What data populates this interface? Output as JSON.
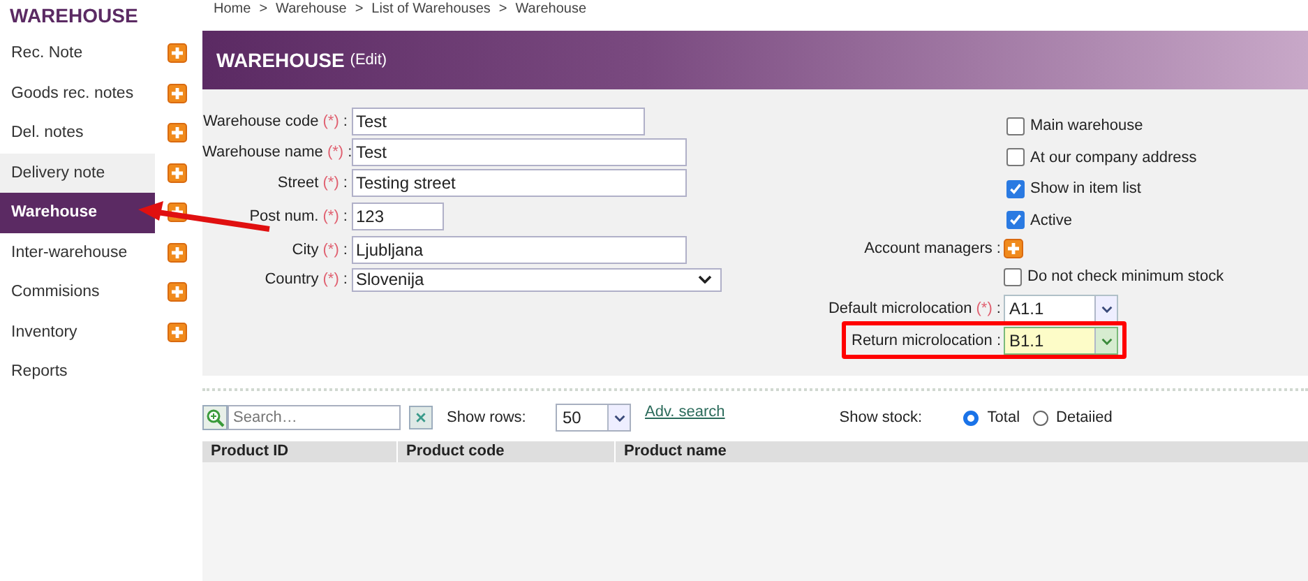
{
  "sidebar": {
    "title": "WAREHOUSE",
    "items": [
      {
        "label": "Rec. Note",
        "selected": false,
        "hovered": false,
        "has_add": true
      },
      {
        "label": "Goods rec. notes",
        "selected": false,
        "hovered": false,
        "has_add": true
      },
      {
        "label": "Del. notes",
        "selected": false,
        "hovered": false,
        "has_add": true
      },
      {
        "label": "Delivery note",
        "selected": false,
        "hovered": true,
        "has_add": true
      },
      {
        "label": "Warehouse",
        "selected": true,
        "hovered": false,
        "has_add": true
      },
      {
        "label": "Inter-warehouse",
        "selected": false,
        "hovered": false,
        "has_add": true
      },
      {
        "label": "Commisions",
        "selected": false,
        "hovered": false,
        "has_add": true
      },
      {
        "label": "Inventory",
        "selected": false,
        "hovered": false,
        "has_add": true
      },
      {
        "label": "Reports",
        "selected": false,
        "hovered": false,
        "has_add": false
      }
    ]
  },
  "breadcrumb": {
    "separator": ">",
    "items": [
      "Home",
      "Warehouse",
      "List of Warehouses",
      "Warehouse"
    ]
  },
  "header": {
    "title": "WAREHOUSE",
    "suffix": "(Edit)"
  },
  "form": {
    "required_mark": "(*)",
    "colon": ":",
    "left_fields": [
      {
        "label": "Warehouse code",
        "required": true,
        "value": "Test",
        "kind": "text"
      },
      {
        "label": "Warehouse name",
        "required": true,
        "value": "Test",
        "kind": "text"
      },
      {
        "label": "Street",
        "required": true,
        "value": "Testing street",
        "kind": "text"
      },
      {
        "label": "Post num.",
        "required": true,
        "value": "123",
        "kind": "text"
      },
      {
        "label": "City",
        "required": true,
        "value": "Ljubljana",
        "kind": "text"
      },
      {
        "label": "Country",
        "required": true,
        "value": "Slovenija",
        "kind": "select"
      }
    ],
    "checkboxes": [
      {
        "label": "Main warehouse",
        "checked": false
      },
      {
        "label": "At our company address",
        "checked": false
      },
      {
        "label": "Show in item list",
        "checked": true
      },
      {
        "label": "Active",
        "checked": true
      }
    ],
    "account_managers": {
      "label": "Account managers"
    },
    "min_stock": {
      "label": "Do not check minimum stock",
      "checked": false
    },
    "microlocations": [
      {
        "label": "Default microlocation",
        "required": true,
        "value": "A1.1",
        "focused": false
      },
      {
        "label": "Return microlocation",
        "required": false,
        "value": "B1.1",
        "focused": true
      }
    ]
  },
  "toolbar": {
    "search": {
      "placeholder": "Search…"
    },
    "rows_label": "Show rows:",
    "rows_value": "50",
    "adv_link": "Adv. search",
    "stock_label": "Show stock:",
    "stock_options": [
      {
        "label": "Total",
        "selected": true
      },
      {
        "label": "Detaiied",
        "selected": false
      }
    ]
  },
  "table": {
    "columns": [
      "Product ID",
      "Product code",
      "Product name"
    ]
  }
}
